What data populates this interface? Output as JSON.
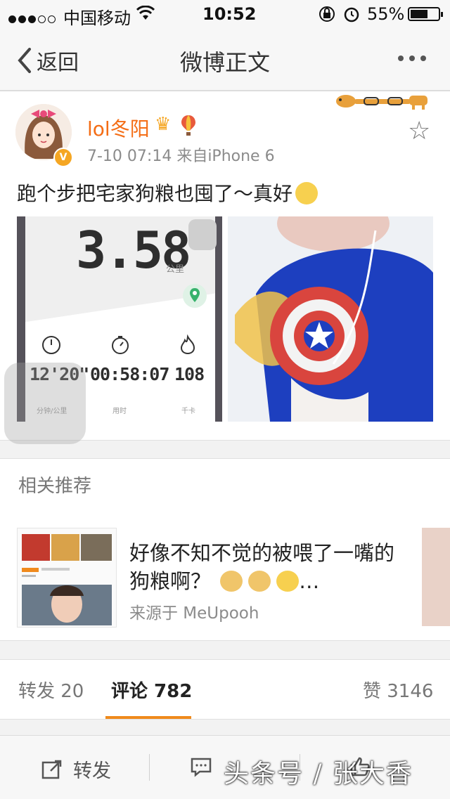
{
  "status_bar": {
    "carrier": "中国移动",
    "time": "10:52",
    "battery": "55%",
    "battery_level": 0.55
  },
  "nav": {
    "back_label": "返回",
    "title": "微博正文"
  },
  "post": {
    "username": "lol冬阳",
    "meta": "7-10 07:14  来自iPhone 6",
    "text": "跑个步把宅家狗粮也囤了～真好",
    "run_card": {
      "distance": "3.58",
      "distance_unit": "公里",
      "pace": "12'20\"",
      "pace_label": "分钟/公里",
      "duration": "00:58:07",
      "duration_label": "用时",
      "calories": "108",
      "calories_label": "千卡"
    }
  },
  "recommend": {
    "section_title": "相关推荐",
    "item_title": "好像不知不觉的被喂了一嘴的狗粮啊？",
    "item_source": "来源于 MeUpooh"
  },
  "tabs": {
    "repost": "转发 20",
    "comment": "评论 782",
    "like": "赞 3146"
  },
  "bottom_bar": {
    "repost": "转发",
    "watermark": "头条号 / 张大香"
  },
  "colors": {
    "accent_orange": "#f08a1c",
    "username_orange": "#f46d15",
    "vip_badge": "#f5a623"
  }
}
